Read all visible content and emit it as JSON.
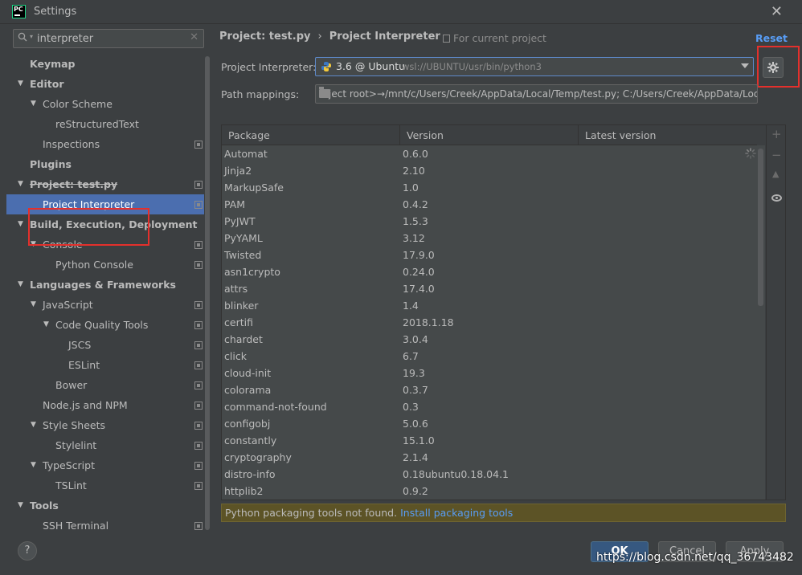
{
  "window": {
    "logo": "PC",
    "title": "Settings"
  },
  "search": {
    "value": "interpreter"
  },
  "tree": [
    {
      "label": "Keymap",
      "level": 0,
      "bold": true,
      "arrow": false,
      "cfg": false
    },
    {
      "label": "Editor",
      "level": 0,
      "bold": true,
      "arrow": true,
      "cfg": false
    },
    {
      "label": "Color Scheme",
      "level": 1,
      "bold": false,
      "arrow": true,
      "cfg": false
    },
    {
      "label": "reStructuredText",
      "level": 2,
      "bold": false,
      "arrow": false,
      "cfg": false
    },
    {
      "label": "Inspections",
      "level": 1,
      "bold": false,
      "arrow": false,
      "cfg": true
    },
    {
      "label": "Plugins",
      "level": 0,
      "bold": true,
      "arrow": false,
      "cfg": false
    },
    {
      "label": "Project: test.py",
      "level": 0,
      "bold": true,
      "arrow": true,
      "cfg": true
    },
    {
      "label": "Project Interpreter",
      "level": 1,
      "bold": false,
      "arrow": false,
      "cfg": true,
      "selected": true
    },
    {
      "label": "Build, Execution, Deployment",
      "level": 0,
      "bold": true,
      "arrow": true,
      "cfg": false
    },
    {
      "label": "Console",
      "level": 1,
      "bold": false,
      "arrow": true,
      "cfg": true
    },
    {
      "label": "Python Console",
      "level": 2,
      "bold": false,
      "arrow": false,
      "cfg": true
    },
    {
      "label": "Languages & Frameworks",
      "level": 0,
      "bold": true,
      "arrow": true,
      "cfg": false
    },
    {
      "label": "JavaScript",
      "level": 1,
      "bold": false,
      "arrow": true,
      "cfg": true
    },
    {
      "label": "Code Quality Tools",
      "level": 2,
      "bold": false,
      "arrow": true,
      "cfg": true
    },
    {
      "label": "JSCS",
      "level": 3,
      "bold": false,
      "arrow": false,
      "cfg": true
    },
    {
      "label": "ESLint",
      "level": 3,
      "bold": false,
      "arrow": false,
      "cfg": true
    },
    {
      "label": "Bower",
      "level": 2,
      "bold": false,
      "arrow": false,
      "cfg": true
    },
    {
      "label": "Node.js and NPM",
      "level": 1,
      "bold": false,
      "arrow": false,
      "cfg": true
    },
    {
      "label": "Style Sheets",
      "level": 1,
      "bold": false,
      "arrow": true,
      "cfg": true
    },
    {
      "label": "Stylelint",
      "level": 2,
      "bold": false,
      "arrow": false,
      "cfg": true
    },
    {
      "label": "TypeScript",
      "level": 1,
      "bold": false,
      "arrow": true,
      "cfg": true
    },
    {
      "label": "TSLint",
      "level": 2,
      "bold": false,
      "arrow": false,
      "cfg": true
    },
    {
      "label": "Tools",
      "level": 0,
      "bold": true,
      "arrow": true,
      "cfg": false
    },
    {
      "label": "SSH Terminal",
      "level": 1,
      "bold": false,
      "arrow": false,
      "cfg": true
    }
  ],
  "breadcrumb": {
    "project": "Project: test.py",
    "separator": "›",
    "page": "Project Interpreter"
  },
  "for_current_project": "For current project",
  "reset_label": "Reset",
  "interpreter": {
    "label": "Project Interpreter:",
    "version": "3.6 @ Ubuntu",
    "path": "wsl://UBUNTU/usr/bin/python3"
  },
  "path_mappings": {
    "label": "Path mappings:",
    "value": "roject root>→/mnt/c/Users/Creek/AppData/Local/Temp/test.py; C:/Users/Creek/AppData/Local"
  },
  "table": {
    "columns": [
      "Package",
      "Version",
      "Latest version"
    ],
    "rows": [
      [
        "Automat",
        "0.6.0",
        ""
      ],
      [
        "Jinja2",
        "2.10",
        ""
      ],
      [
        "MarkupSafe",
        "1.0",
        ""
      ],
      [
        "PAM",
        "0.4.2",
        ""
      ],
      [
        "PyJWT",
        "1.5.3",
        ""
      ],
      [
        "PyYAML",
        "3.12",
        ""
      ],
      [
        "Twisted",
        "17.9.0",
        ""
      ],
      [
        "asn1crypto",
        "0.24.0",
        ""
      ],
      [
        "attrs",
        "17.4.0",
        ""
      ],
      [
        "blinker",
        "1.4",
        ""
      ],
      [
        "certifi",
        "2018.1.18",
        ""
      ],
      [
        "chardet",
        "3.0.4",
        ""
      ],
      [
        "click",
        "6.7",
        ""
      ],
      [
        "cloud-init",
        "19.3",
        ""
      ],
      [
        "colorama",
        "0.3.7",
        ""
      ],
      [
        "command-not-found",
        "0.3",
        ""
      ],
      [
        "configobj",
        "5.0.6",
        ""
      ],
      [
        "constantly",
        "15.1.0",
        ""
      ],
      [
        "cryptography",
        "2.1.4",
        ""
      ],
      [
        "distro-info",
        "0.18ubuntu0.18.04.1",
        ""
      ],
      [
        "httplib2",
        "0.9.2",
        ""
      ]
    ]
  },
  "warning": {
    "text": "Python packaging tools not found.",
    "link": "Install packaging tools"
  },
  "buttons": {
    "help": "?",
    "ok": "OK",
    "cancel": "Cancel",
    "apply": "Apply"
  },
  "watermark": "https://blog.csdn.net/qq_36743482",
  "colors": {
    "selection": "#4b6eaf",
    "link": "#589df6",
    "highlight_box": "#e4302c",
    "warning_bg": "#5c5326"
  }
}
